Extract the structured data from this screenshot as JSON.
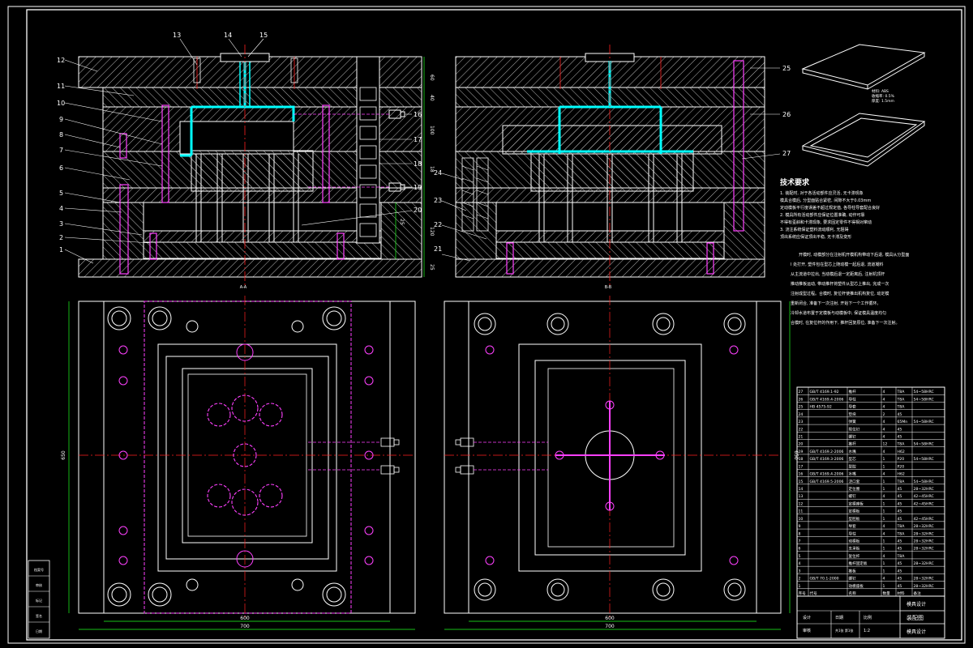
{
  "colors": {
    "background": "#000000",
    "frame": "#ffffff",
    "hatch": "#c8c8c8",
    "centerline": "#ff2020",
    "dimension": "#20ff20",
    "pin": "#ff40ff",
    "runner": "#00ffff",
    "part": "#e8e8e8",
    "text": "#ffffff"
  },
  "section_views": {
    "left_label": "A-A",
    "right_label": "B-B"
  },
  "callouts_left": [
    "1",
    "2",
    "3",
    "4",
    "5",
    "6",
    "7",
    "8",
    "9",
    "10",
    "11",
    "12"
  ],
  "callouts_top": [
    "13",
    "14",
    "15"
  ],
  "callouts_mid": [
    "16",
    "17",
    "18",
    "19",
    "20"
  ],
  "callouts_right": [
    "21",
    "22",
    "23",
    "24",
    "25",
    "26",
    "27"
  ],
  "vertical_dims": [
    "60",
    "40",
    "100",
    "18",
    "120",
    "25",
    "25"
  ],
  "plan_dims": {
    "left_width_inner": "600",
    "left_width_outer": "700",
    "left_height": "650",
    "right_width_inner": "600",
    "right_width_outer": "700",
    "right_height": "650"
  },
  "part_notes": [
    "材料: ABS",
    "收缩率: 0.5%",
    "厚度: 1.5mm"
  ],
  "tech_title": "技术要求",
  "tech_requirements": [
    "1. 装配时, 对于各活动部件应灵活, 无卡滞现象",
    "模具合模后, 分型面贴合紧密, 间隙不大于0.03mm",
    "定动模板平行度误差不超过规定值, 各导柱导套配合良好",
    "2. 模具所有活动部件应保证位置准确, 动作可靠",
    "不得有歪斜和卡滞现象, 要求固定零件不得相对窜动",
    "3. 浇注系统保证塑料流动顺利, 无阻碍",
    "顶出系统应保证顶出平稳, 无卡滞及变形"
  ],
  "working_principle": [
    "开模时, 动模部分在注射机开模机构带动下后退, 模具从分型面",
    "I 处打开, 塑件包在型芯上随动模一起后退, 流道凝料",
    "从主流道中拉出, 当动模后退一定距离后, 注射机顶杆",
    "推动推板运动, 带动推杆将塑件从型芯上推出, 完成一次",
    "注射成型过程。合模时, 复位杆使推出机构复位, 动定模",
    "重新闭合, 准备下一次注射, 开始下一个工作循环。",
    "冷却水道布置于定模板与动模板中, 保证模具温度均匀",
    "合模时, 在复位杆的作用下, 推杆回复原位, 准备下一次注射。"
  ],
  "bom_header": [
    "序号",
    "代号",
    "名称",
    "数量",
    "材料",
    "备注"
  ],
  "bom_rows": [
    [
      "27",
      "GB/T 4169.1-92",
      "推杆",
      "4",
      "T8A",
      "54~58HRC"
    ],
    [
      "26",
      "GB/T 4169.4-2006",
      "导柱",
      "4",
      "T8A",
      "54~58HRC"
    ],
    [
      "25",
      "HB 4575-92",
      "导套",
      "4",
      "T8A",
      ""
    ],
    [
      "24",
      "",
      "垫块",
      "2",
      "45",
      ""
    ],
    [
      "23",
      "",
      "弹簧",
      "4",
      "65Mn",
      "54~58HRC"
    ],
    [
      "22",
      "",
      "限位钉",
      "4",
      "45",
      ""
    ],
    [
      "21",
      "",
      "螺钉",
      "4",
      "45",
      ""
    ],
    [
      "20",
      "",
      "推杆",
      "12",
      "T8A",
      "54~58HRC"
    ],
    [
      "19",
      "GB/T 4169.2-2006",
      "水嘴",
      "4",
      "H62",
      ""
    ],
    [
      "18",
      "GB/T 4169.3-2006",
      "型芯",
      "1",
      "P20",
      "54~58HRC"
    ],
    [
      "17",
      "",
      "型腔",
      "1",
      "P20",
      ""
    ],
    [
      "16",
      "GB/T 4169.4-2006",
      "水嘴",
      "4",
      "H62",
      ""
    ],
    [
      "15",
      "GB/T 4169.5-2006",
      "浇口套",
      "1",
      "T8A",
      "54~58HRC"
    ],
    [
      "14",
      "",
      "定位圈",
      "1",
      "45",
      "28~32HRC"
    ],
    [
      "13",
      "",
      "螺钉",
      "4",
      "45",
      "42~45HRC"
    ],
    [
      "12",
      "",
      "定模座板",
      "1",
      "45",
      "42~45HRC"
    ],
    [
      "11",
      "",
      "定模板",
      "1",
      "45",
      ""
    ],
    [
      "10",
      "",
      "型腔板",
      "1",
      "45",
      "42~45HRC"
    ],
    [
      "9",
      "",
      "导套",
      "4",
      "T8A",
      "28~32HRC"
    ],
    [
      "8",
      "",
      "导柱",
      "4",
      "T8A",
      "28~32HRC"
    ],
    [
      "7",
      "",
      "动模板",
      "1",
      "45",
      "28~32HRC"
    ],
    [
      "6",
      "",
      "支承板",
      "1",
      "45",
      "28~32HRC"
    ],
    [
      "5",
      "",
      "复位杆",
      "4",
      "T8A",
      ""
    ],
    [
      "4",
      "",
      "推杆固定板",
      "1",
      "45",
      "28~32HRC"
    ],
    [
      "3",
      "",
      "推板",
      "1",
      "45",
      ""
    ],
    [
      "2",
      "GB/T 70.1-2000",
      "螺钉",
      "4",
      "45",
      "28~32HRC"
    ],
    [
      "1",
      "",
      "动模座板",
      "1",
      "45",
      "28~32HRC"
    ]
  ],
  "title_block": {
    "scale_label": "比例",
    "scale": "1:2",
    "drawing_title": "装配图",
    "sheet_note": "共1张 第1张",
    "school": "模具设计",
    "designer_label": "设计",
    "checker_label": "审核",
    "date_label": "日期"
  },
  "left_stamp": [
    "档案号",
    "审核",
    "标记",
    "签名",
    "日期"
  ]
}
